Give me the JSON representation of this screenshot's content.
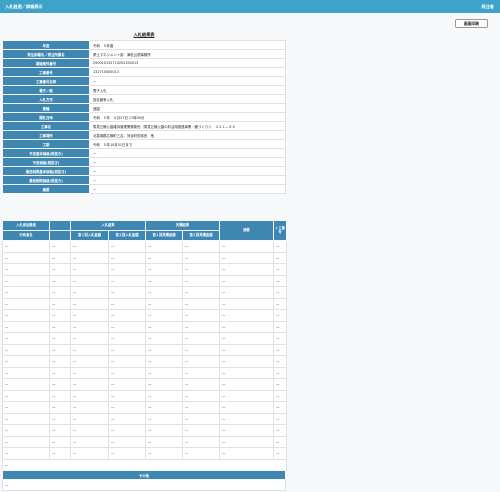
{
  "header": {
    "title": "入札経過／詳細表示",
    "right_label": "発注者"
  },
  "print_button": "画面印刷",
  "section_title": "入札結果表",
  "info_rows": [
    {
      "label": "年度",
      "value": "令和　５年度"
    },
    {
      "label": "発注部署名／発注所属名",
      "value": "県土マネジメント部　津松山関事務所"
    },
    {
      "label": "調達案件番号",
      "value": "290010132710202330013"
    },
    {
      "label": "工事番号",
      "value": "132710505013"
    },
    {
      "label": "工事番号名称",
      "value": "—"
    },
    {
      "label": "電子／紙",
      "value": "電子入札"
    },
    {
      "label": "入札方式",
      "value": "指名競争入札"
    },
    {
      "label": "業種",
      "value": "造園"
    },
    {
      "label": "開札日時",
      "value": "令和　５年　６月27日 17時30分"
    },
    {
      "label": "工事名",
      "value": "馬見丘陵公園維持管理業務委託（馬見丘陵公園の利活用推進事業（都づくり））　４２１—９６"
    },
    {
      "label": "工事場所",
      "value": "北葛城郡広陵町三吉、河合町佐味田　他"
    },
    {
      "label": "工期",
      "value": "令和　５年10月31日まで"
    },
    {
      "label": "予定基本価格(税抜き)",
      "value": "—"
    },
    {
      "label": "予定価格(税抜き)",
      "value": "—"
    },
    {
      "label": "最低制限基本価格(税抜き)",
      "value": "—"
    },
    {
      "label": "最低制限価格(税抜き)",
      "value": "—"
    },
    {
      "label": "摘要",
      "value": "—"
    }
  ],
  "bid_table": {
    "h_bidder": "入札参加業者",
    "h_company": "行政者名",
    "h_bid_amount": "入札結果",
    "h_first_bid": "第１回入札金額",
    "h_second_bid": "第２回入札金額",
    "h_quality": "見積結果",
    "h_first_quote": "第１回見積金額",
    "h_second_quote": "第２回見積金額",
    "h_remarks": "摘要",
    "h_number": "くじ番号",
    "rows": [
      [
        "—",
        "—",
        "—",
        "—",
        "—",
        "—",
        "—",
        "—"
      ],
      [
        "—",
        "—",
        "—",
        "—",
        "—",
        "—",
        "—",
        "—"
      ],
      [
        "—",
        "—",
        "—",
        "—",
        "—",
        "—",
        "—",
        "—"
      ],
      [
        "—",
        "—",
        "—",
        "—",
        "—",
        "—",
        "—",
        "—"
      ],
      [
        "—",
        "—",
        "—",
        "—",
        "—",
        "—",
        "—",
        "—"
      ],
      [
        "—",
        "—",
        "—",
        "—",
        "—",
        "—",
        "—",
        "—"
      ],
      [
        "—",
        "—",
        "—",
        "—",
        "—",
        "—",
        "—",
        "—"
      ],
      [
        "—",
        "—",
        "—",
        "—",
        "—",
        "—",
        "—",
        "—"
      ],
      [
        "—",
        "—",
        "—",
        "—",
        "—",
        "—",
        "—",
        "—"
      ],
      [
        "—",
        "—",
        "—",
        "—",
        "—",
        "—",
        "—",
        "—"
      ],
      [
        "—",
        "—",
        "—",
        "—",
        "—",
        "—",
        "—",
        "—"
      ],
      [
        "—",
        "—",
        "—",
        "—",
        "—",
        "—",
        "—",
        "—"
      ],
      [
        "—",
        "—",
        "—",
        "—",
        "—",
        "—",
        "—",
        "—"
      ],
      [
        "—",
        "—",
        "—",
        "—",
        "—",
        "—",
        "—",
        "—"
      ],
      [
        "—",
        "—",
        "—",
        "—",
        "—",
        "—",
        "—",
        "—"
      ],
      [
        "—",
        "—",
        "—",
        "—",
        "—",
        "—",
        "—",
        "—"
      ],
      [
        "—",
        "—",
        "—",
        "—",
        "—",
        "—",
        "—",
        "—"
      ],
      [
        "—",
        "—",
        "—",
        "—",
        "—",
        "—",
        "—",
        "—"
      ],
      [
        "—",
        "—",
        "—",
        "—",
        "—",
        "—",
        "—",
        "—"
      ]
    ],
    "footer_value": "—"
  },
  "other": {
    "title": "その他",
    "value": "—"
  }
}
